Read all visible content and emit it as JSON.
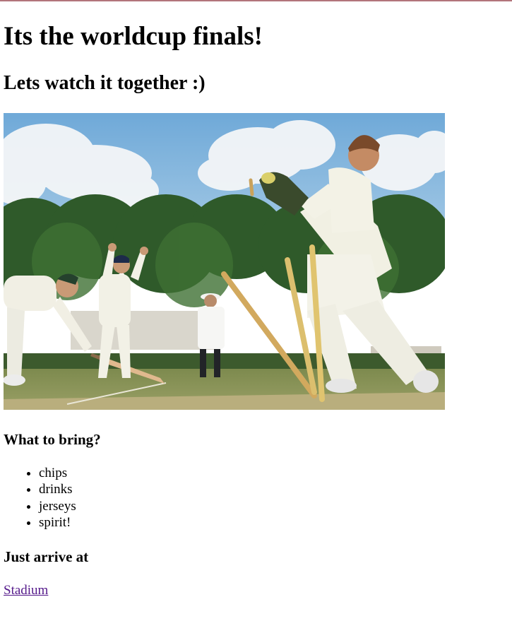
{
  "page": {
    "heading": "Its the worldcup finals!",
    "subheading": "Lets watch it together :)"
  },
  "photo": {
    "subject": "cricket-match-photo"
  },
  "bring": {
    "title": "What to bring?",
    "items": [
      "chips",
      "drinks",
      "jerseys",
      "spirit!"
    ]
  },
  "arrive": {
    "title": "Just arrive at",
    "link_text": "Stadium"
  },
  "colors": {
    "link_visited": "#551a8b",
    "topbar": "#b2747b"
  }
}
